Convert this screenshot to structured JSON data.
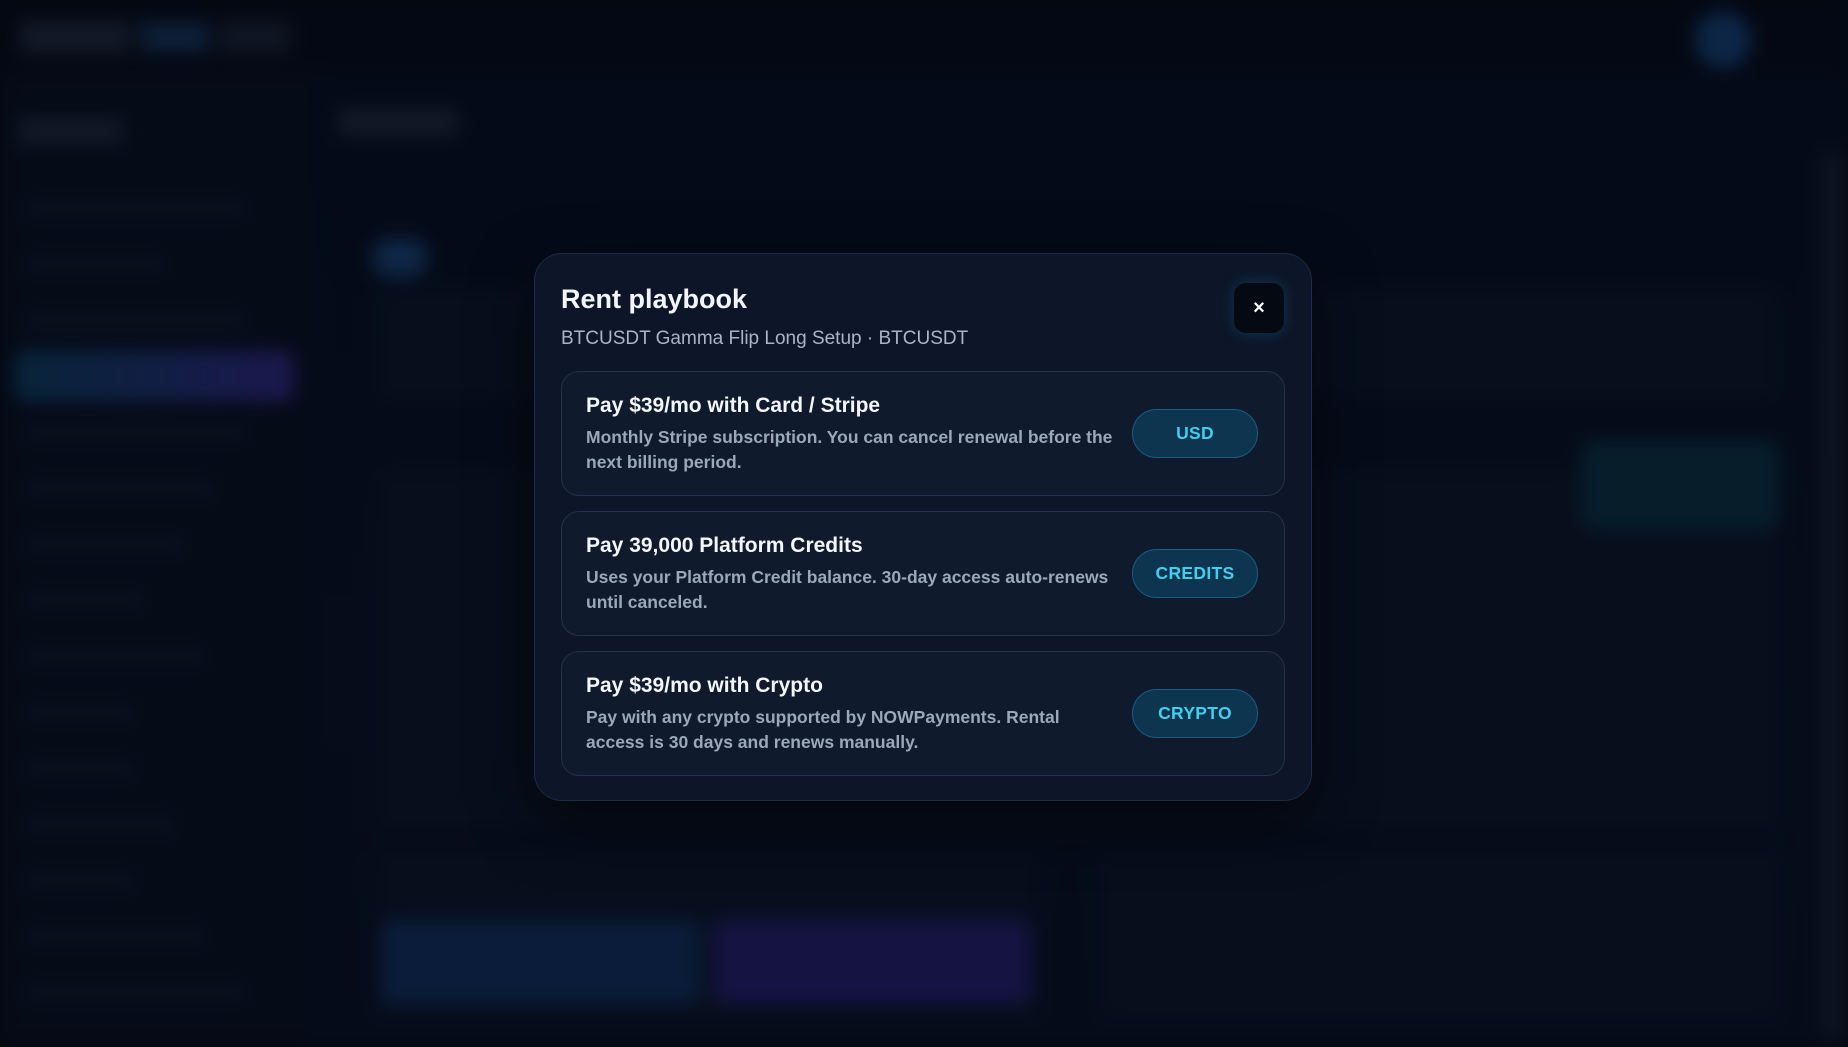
{
  "modal": {
    "title": "Rent playbook",
    "subtitle": "BTCUSDT Gamma Flip Long Setup · BTCUSDT",
    "close_label": "×",
    "options": [
      {
        "title": "Pay $39/mo with Card / Stripe",
        "description": "Monthly Stripe subscription. You can cancel renewal before the next billing period.",
        "button_label": "USD"
      },
      {
        "title": "Pay 39,000 Platform Credits",
        "description": "Uses your Platform Credit balance. 30-day access auto-renews until canceled.",
        "button_label": "CREDITS"
      },
      {
        "title": "Pay $39/mo with Crypto",
        "description": "Pay with any crypto supported by NOWPayments. Rental access is 30 days and renews manually.",
        "button_label": "CRYPTO"
      }
    ]
  },
  "icons": {
    "close": "close-icon"
  },
  "colors": {
    "accent": "#3fd0f0",
    "modal_background": "#0c1628",
    "button_background": "#0d3550"
  }
}
